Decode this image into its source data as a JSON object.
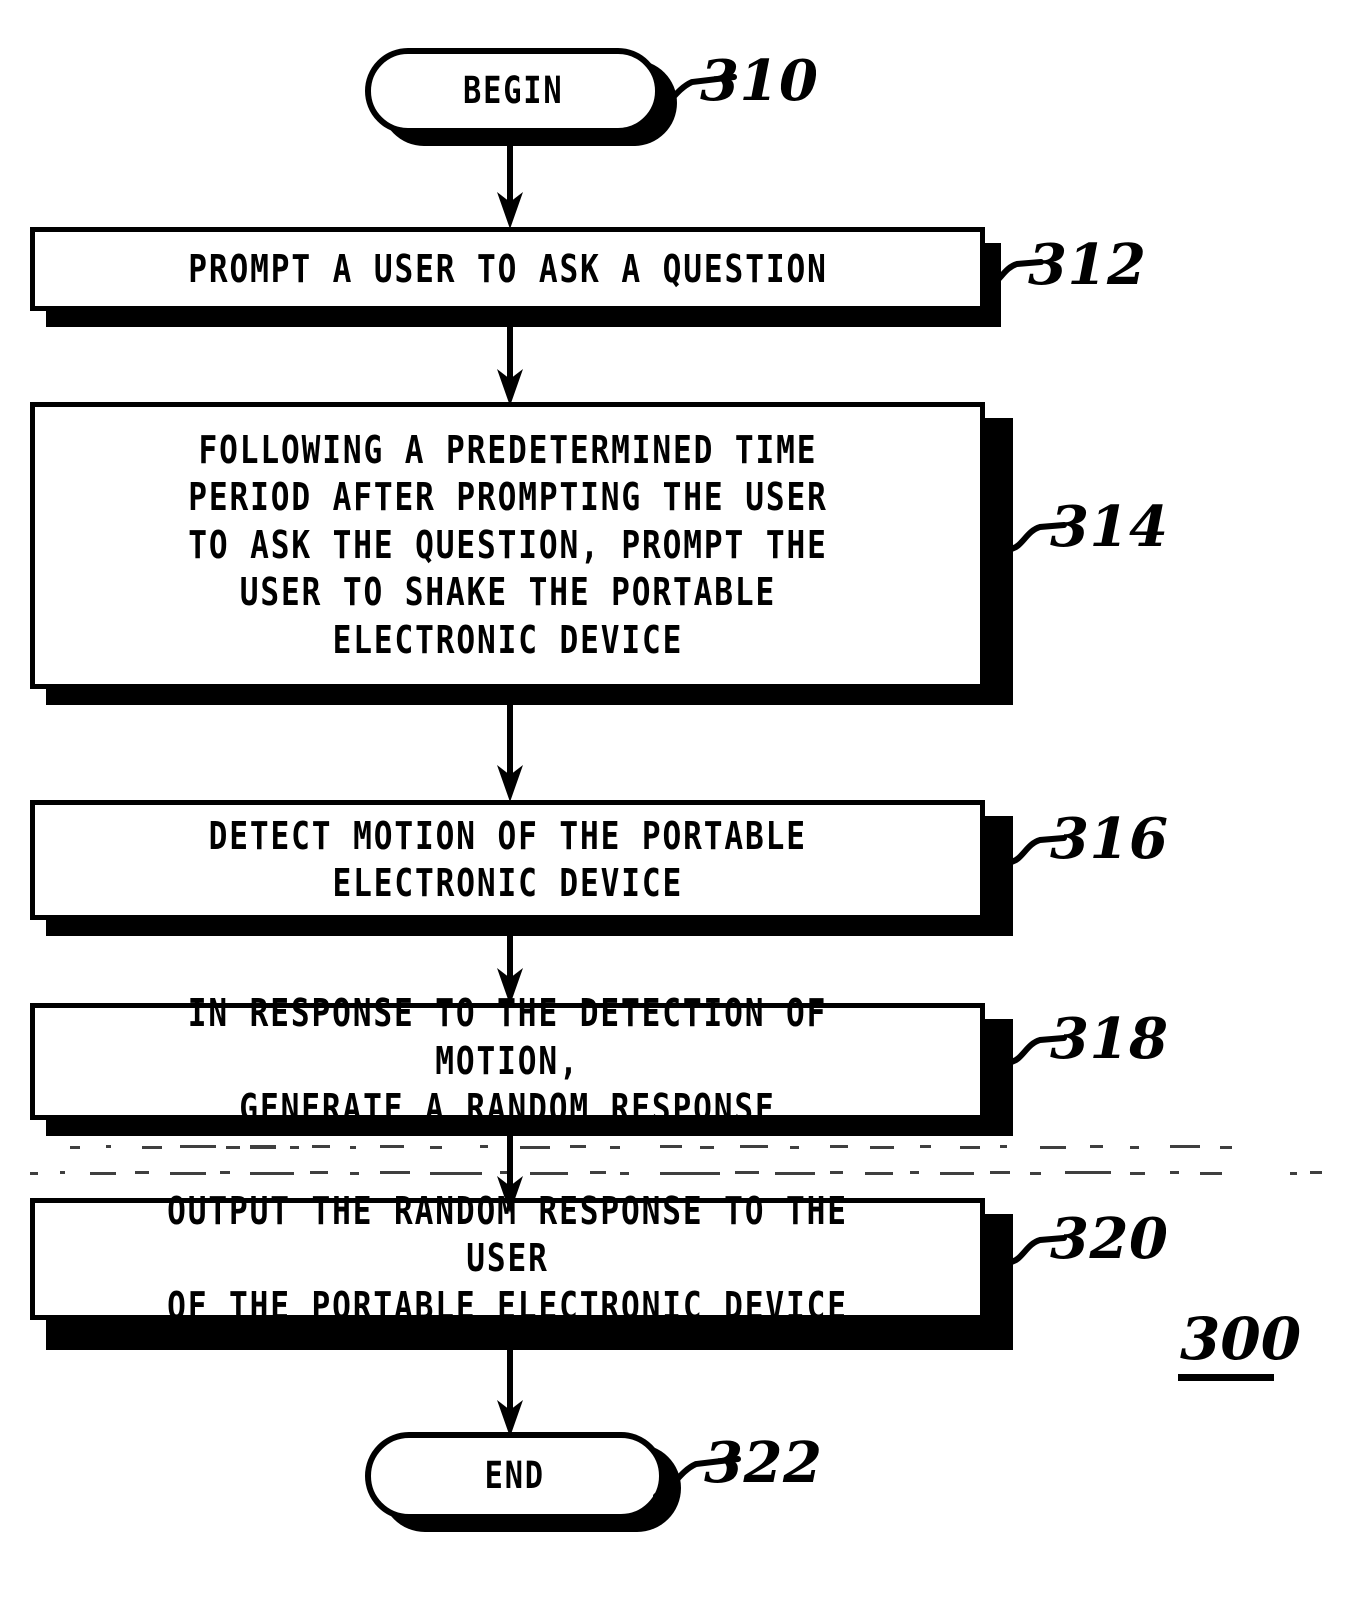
{
  "figure": {
    "number": "300",
    "title_label": "300"
  },
  "nodes": [
    {
      "id": "begin",
      "ref": "310",
      "shape": "terminator",
      "text": "BEGIN"
    },
    {
      "id": "step312",
      "ref": "312",
      "shape": "process",
      "text": "PROMPT A USER TO ASK A QUESTION"
    },
    {
      "id": "step314",
      "ref": "314",
      "shape": "process",
      "text": "FOLLOWING A PREDETERMINED TIME\nPERIOD AFTER PROMPTING THE USER\nTO ASK THE QUESTION, PROMPT THE\nUSER TO SHAKE THE PORTABLE\nELECTRONIC DEVICE"
    },
    {
      "id": "step316",
      "ref": "316",
      "shape": "process",
      "text": "DETECT MOTION OF THE PORTABLE\nELECTRONIC DEVICE"
    },
    {
      "id": "step318",
      "ref": "318",
      "shape": "process",
      "text": "IN RESPONSE TO THE DETECTION OF MOTION,\nGENERATE A RANDOM RESPONSE"
    },
    {
      "id": "step320",
      "ref": "320",
      "shape": "process",
      "text": "OUTPUT THE RANDOM RESPONSE TO THE USER\nOF THE PORTABLE ELECTRONIC DEVICE"
    },
    {
      "id": "end",
      "ref": "322",
      "shape": "terminator",
      "text": "END"
    }
  ],
  "colors": {
    "ink": "#000000",
    "paper": "#ffffff"
  }
}
